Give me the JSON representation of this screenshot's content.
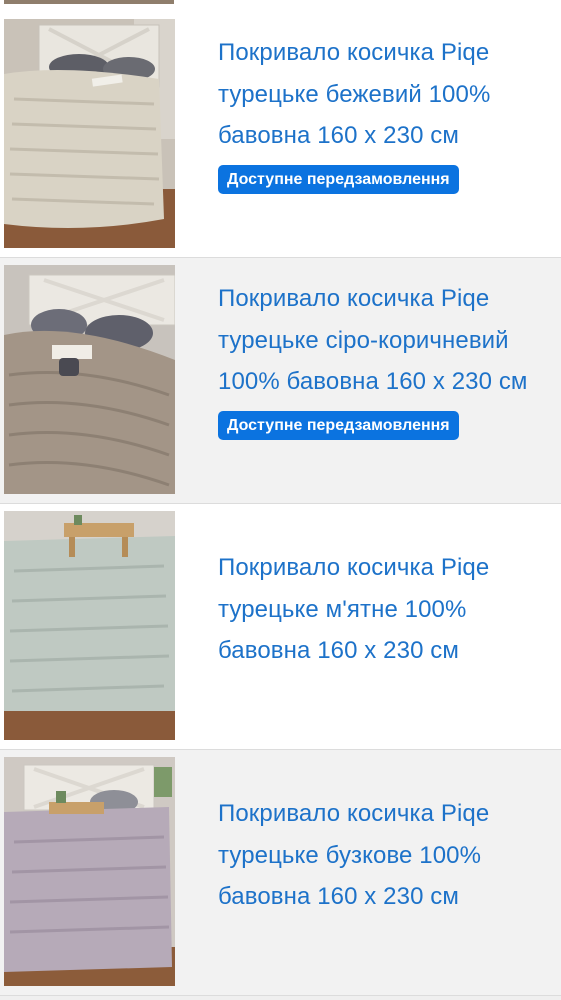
{
  "products": [
    {
      "title": "Покривало косичка Piqe турецьке бежевий 100% бавовна 160 х 230 см",
      "badge": "Доступне передзамовлення",
      "thumb_icon": "beige-bedspread-photo",
      "colors": {
        "wall": "#c9c2b8",
        "floor": "#8a5a3a",
        "throw": "#d9d3c5",
        "pillow": "#5d5e66",
        "board": "#e9e6df"
      }
    },
    {
      "title": "Покривало косичка Piqe турецьке сіро-коричневий 100% бавовна 160 х 230 см",
      "badge": "Доступне передзамовлення",
      "thumb_icon": "grey-brown-bedspread-photo",
      "colors": {
        "wall": "#c8c3bd",
        "floor": "#7a5235",
        "throw": "#a39587",
        "pillow": "#6c6d78",
        "board": "#ebe8e2"
      }
    },
    {
      "title": "Покривало косичка Piqe турецьке м'ятне 100% бавовна 160 х 230 см",
      "badge": "",
      "thumb_icon": "mint-bedspread-photo",
      "colors": {
        "wall": "#d6d2cc",
        "floor": "#86563a",
        "throw": "#bfc9c2",
        "pillow": "#a3a9a3",
        "board": "#e4e1db"
      }
    },
    {
      "title": "Покривало косичка Piqe турецьке бузкове 100% бавовна 160 х 230 см",
      "badge": "",
      "thumb_icon": "lilac-bedspread-photo",
      "colors": {
        "wall": "#cfc9c3",
        "floor": "#8c5c3a",
        "throw": "#b6aab8",
        "pillow": "#8e8f97",
        "board": "#ece9e3"
      }
    }
  ]
}
